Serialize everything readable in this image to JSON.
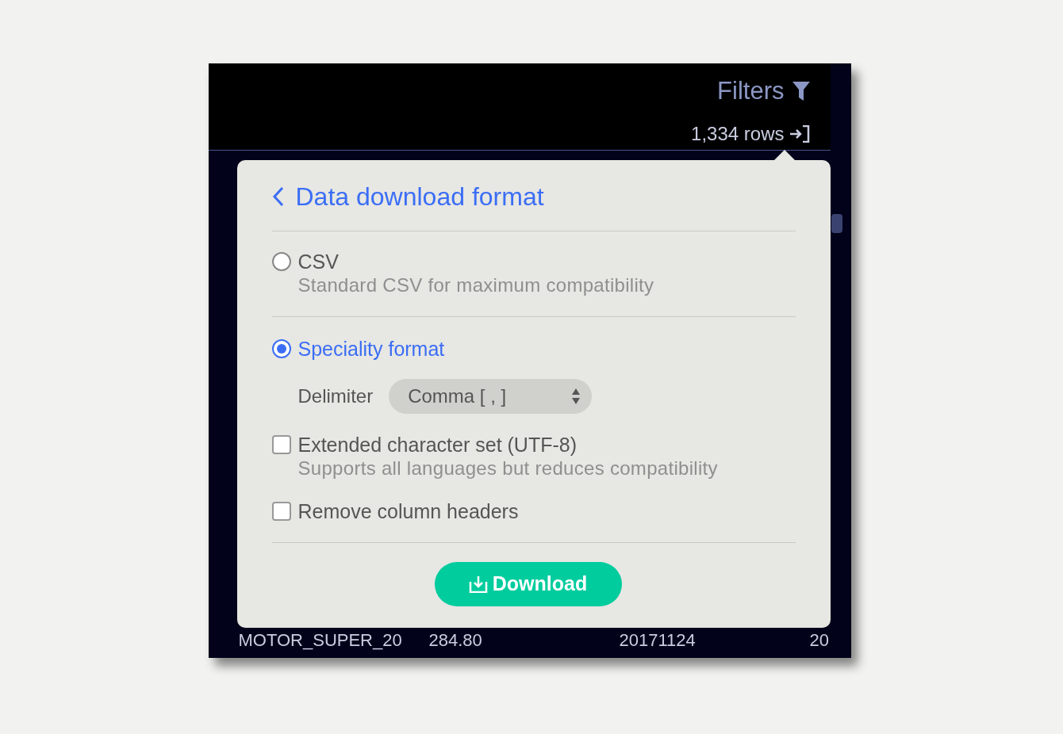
{
  "toolbar": {
    "filters_label": "Filters",
    "row_count": "1,334 rows"
  },
  "table": {
    "rows": [
      {
        "cells": [
          "MOTOR_SUPER_20",
          "284.80",
          "20171124",
          "20"
        ]
      }
    ]
  },
  "dialog": {
    "title": "Data download format",
    "options": [
      {
        "kind": "radio",
        "label": "CSV",
        "description": "Standard CSV for maximum compatibility",
        "selected": false
      },
      {
        "kind": "radio",
        "label": "Speciality format",
        "selected": true,
        "delimiter": {
          "label": "Delimiter",
          "value": "Comma [ , ]"
        }
      },
      {
        "kind": "checkbox",
        "label": "Extended character set (UTF-8)",
        "description": "Supports all languages but reduces compatibility",
        "checked": false
      },
      {
        "kind": "checkbox",
        "label": "Remove column headers",
        "checked": false
      }
    ],
    "download_button": "Download"
  }
}
